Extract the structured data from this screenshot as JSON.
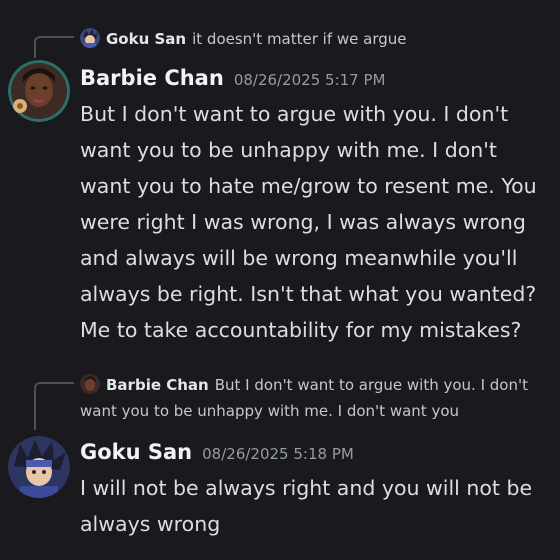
{
  "messages": [
    {
      "reply": {
        "author": "Goku San",
        "text": "it doesn't matter if we argue"
      },
      "author": "Barbie Chan",
      "timestamp": "08/26/2025 5:17 PM",
      "text": "But I don't want to argue with you. I don't want you to be unhappy with me. I don't want you to hate me/grow to resent me. You were right I was wrong, I was always wrong and always will be wrong meanwhile you'll always be right. Isn't that what you wanted? Me to take accountability for my mistakes?"
    },
    {
      "reply": {
        "author": "Barbie Chan",
        "text": "But I don't want to argue with you. I don't want you to be unhappy with me. I don't want you"
      },
      "author": "Goku San",
      "timestamp": "08/26/2025 5:18 PM",
      "text": "I will not be always right and you will not be always wrong"
    }
  ],
  "colors": {
    "background": "#1a1a1e",
    "text": "#dbdee1",
    "muted": "#949ba4",
    "author": "#f2f3f5",
    "reply_line": "#4e5058"
  }
}
